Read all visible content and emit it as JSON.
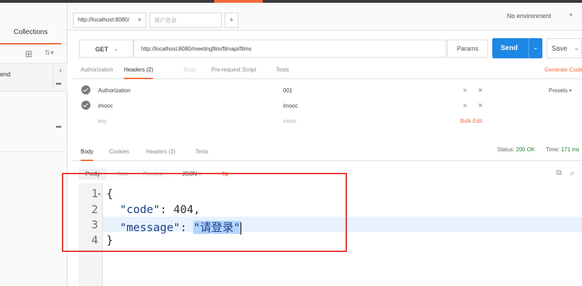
{
  "colors": {
    "accent": "#f26b3a",
    "send": "#1e88e5",
    "status_ok": "#2e7d32",
    "annotation": "#e53935"
  },
  "sidebar": {
    "tab_label": "Collections",
    "item_label": "end",
    "expand_icon": "chevron-right-icon",
    "newfolder_icon": "new-folder-icon",
    "sort_icon": "sort-icon",
    "newfolder_glyph": "⊞",
    "sort_glyph": "⇅▾",
    "chevron_glyph": "›",
    "more_glyph": "•••"
  },
  "tabs": {
    "items": [
      {
        "label": "http://localhost:8080/"
      },
      {
        "label": "用户登录"
      }
    ],
    "close_glyph": "✕",
    "add_glyph": "+",
    "environment": "No environment",
    "caret_glyph": "▾"
  },
  "request": {
    "method": "GET",
    "url": "http://localhost:8080/meetingfilm/filmapi/films",
    "params_label": "Params",
    "send_label": "Send",
    "save_label": "Save",
    "caret_glyph": "⌄"
  },
  "req_tabs": {
    "authorization": "Authorization",
    "headers": "Headers",
    "headers_count": "(2)",
    "body": "Body",
    "prerequest": "Pre-request Script",
    "tests": "Tests",
    "generate_code": "Generate Code"
  },
  "headers": {
    "rows": [
      {
        "key": "Authorization",
        "value": "001"
      },
      {
        "key": "imooc",
        "value": "imooc"
      }
    ],
    "key_placeholder": "key",
    "value_placeholder": "value",
    "bulk_edit": "Bulk Edit",
    "presets": "Presets",
    "menu_glyph": "≡",
    "delete_glyph": "✕"
  },
  "response": {
    "tabs": {
      "body": "Body",
      "cookies": "Cookies",
      "headers": "Headers",
      "headers_count": "(3)",
      "tests": "Tests"
    },
    "status_label": "Status:",
    "status_value": "200 OK",
    "time_label": "Time:",
    "time_value": "171 ms",
    "view": {
      "pretty": "Pretty",
      "raw": "Raw",
      "preview": "Preview",
      "format": "JSON",
      "wrap_glyph": "⇆",
      "copy_glyph": "⧉",
      "search_glyph": "⌕"
    },
    "line_numbers": [
      "1",
      "2",
      "3",
      "4"
    ],
    "fold_glyph": "▾",
    "code": {
      "open_brace": "{",
      "key_code": "\"code\"",
      "colon": ": ",
      "value_code": "404",
      "comma": ",",
      "key_message": "\"message\"",
      "value_message": "\"请登录\"",
      "close_brace": "}"
    }
  }
}
